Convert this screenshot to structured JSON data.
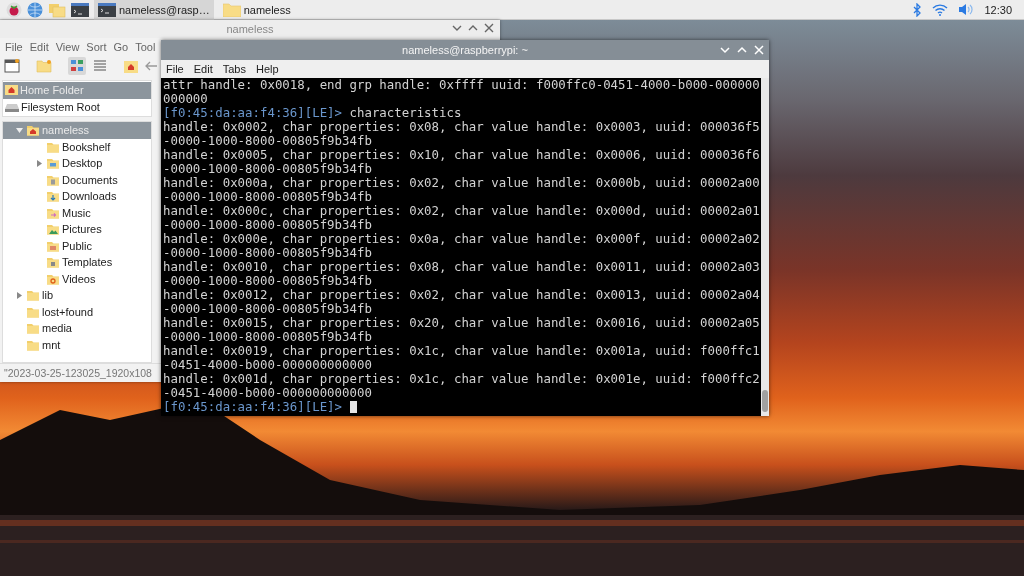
{
  "taskbar": {
    "tasks": [
      {
        "label": "nameless@rasp…",
        "kind": "terminal",
        "selected": true
      },
      {
        "label": "nameless",
        "kind": "folder",
        "selected": false
      }
    ],
    "clock": "12:30"
  },
  "file_manager": {
    "title": "nameless",
    "menu": [
      "File",
      "Edit",
      "View",
      "Sort",
      "Go",
      "Tool"
    ],
    "places": [
      {
        "label": "Home Folder",
        "kind": "home",
        "selected": true
      },
      {
        "label": "Filesystem Root",
        "kind": "drive",
        "selected": false
      }
    ],
    "tree": [
      {
        "label": "nameless",
        "kind": "home",
        "expanded": true,
        "selected": true,
        "children": [
          {
            "label": "Bookshelf",
            "kind": "plain",
            "selected": false
          },
          {
            "label": "Desktop",
            "kind": "desktop",
            "expanded": false,
            "selected": false
          },
          {
            "label": "Documents",
            "kind": "documents",
            "selected": false
          },
          {
            "label": "Downloads",
            "kind": "downloads",
            "selected": false
          },
          {
            "label": "Music",
            "kind": "music",
            "selected": false
          },
          {
            "label": "Pictures",
            "kind": "pictures",
            "selected": false
          },
          {
            "label": "Public",
            "kind": "public",
            "selected": false
          },
          {
            "label": "Templates",
            "kind": "templates",
            "selected": false
          },
          {
            "label": "Videos",
            "kind": "videos",
            "selected": false
          }
        ]
      },
      {
        "label": "lib",
        "kind": "plain",
        "expanded": false,
        "selected": false
      },
      {
        "label": "lost+found",
        "kind": "plain",
        "selected": false
      },
      {
        "label": "media",
        "kind": "plain",
        "selected": false
      },
      {
        "label": "mnt",
        "kind": "plain",
        "selected": false
      }
    ],
    "status_bar": "\"2023-03-25-123025_1920x108"
  },
  "terminal": {
    "title": "nameless@raspberrypi: ~",
    "menu": [
      "File",
      "Edit",
      "Tabs",
      "Help"
    ],
    "lines": [
      {
        "kind": "output",
        "text": "attr handle: 0x0018, end grp handle: 0xffff uuid: f000ffc0-0451-4000-b000-000000"
      },
      {
        "kind": "output",
        "text": "000000"
      },
      {
        "kind": "prompt",
        "prompt": "[f0:45:da:aa:f4:36][LE]>",
        "command": "characteristics"
      },
      {
        "kind": "output",
        "text": "handle: 0x0002, char properties: 0x08, char value handle: 0x0003, uuid: 000036f5"
      },
      {
        "kind": "output",
        "text": "-0000-1000-8000-00805f9b34fb"
      },
      {
        "kind": "output",
        "text": "handle: 0x0005, char properties: 0x10, char value handle: 0x0006, uuid: 000036f6"
      },
      {
        "kind": "output",
        "text": "-0000-1000-8000-00805f9b34fb"
      },
      {
        "kind": "output",
        "text": "handle: 0x000a, char properties: 0x02, char value handle: 0x000b, uuid: 00002a00"
      },
      {
        "kind": "output",
        "text": "-0000-1000-8000-00805f9b34fb"
      },
      {
        "kind": "output",
        "text": "handle: 0x000c, char properties: 0x02, char value handle: 0x000d, uuid: 00002a01"
      },
      {
        "kind": "output",
        "text": "-0000-1000-8000-00805f9b34fb"
      },
      {
        "kind": "output",
        "text": "handle: 0x000e, char properties: 0x0a, char value handle: 0x000f, uuid: 00002a02"
      },
      {
        "kind": "output",
        "text": "-0000-1000-8000-00805f9b34fb"
      },
      {
        "kind": "output",
        "text": "handle: 0x0010, char properties: 0x08, char value handle: 0x0011, uuid: 00002a03"
      },
      {
        "kind": "output",
        "text": "-0000-1000-8000-00805f9b34fb"
      },
      {
        "kind": "output",
        "text": "handle: 0x0012, char properties: 0x02, char value handle: 0x0013, uuid: 00002a04"
      },
      {
        "kind": "output",
        "text": "-0000-1000-8000-00805f9b34fb"
      },
      {
        "kind": "output",
        "text": "handle: 0x0015, char properties: 0x20, char value handle: 0x0016, uuid: 00002a05"
      },
      {
        "kind": "output",
        "text": "-0000-1000-8000-00805f9b34fb"
      },
      {
        "kind": "output",
        "text": "handle: 0x0019, char properties: 0x1c, char value handle: 0x001a, uuid: f000ffc1"
      },
      {
        "kind": "output",
        "text": "-0451-4000-b000-000000000000"
      },
      {
        "kind": "output",
        "text": "handle: 0x001d, char properties: 0x1c, char value handle: 0x001e, uuid: f000ffc2"
      },
      {
        "kind": "output",
        "text": "-0451-4000-b000-000000000000"
      },
      {
        "kind": "prompt",
        "prompt": "[f0:45:da:aa:f4:36][LE]>",
        "cursor": true
      }
    ]
  }
}
